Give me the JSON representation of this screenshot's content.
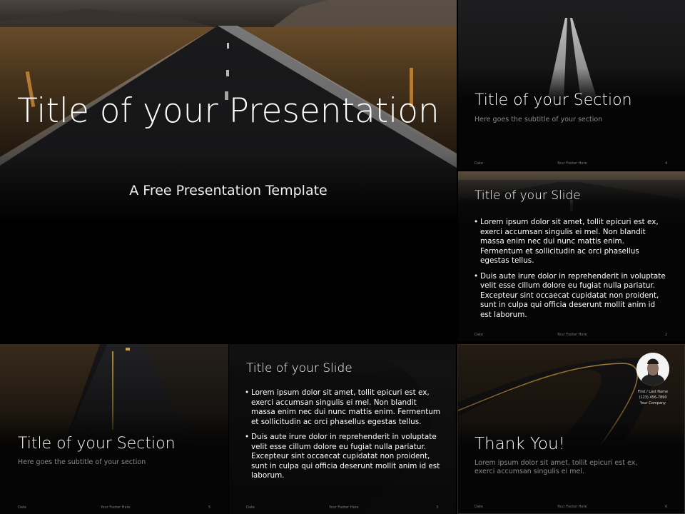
{
  "main_slide": {
    "title": "Title of your Presentation",
    "subtitle": "A Free Presentation Template"
  },
  "section_slide_1": {
    "title": "Title of your Section",
    "subtitle": "Here goes the subtitle of your section",
    "footer": {
      "date": "Date",
      "text": "Your Footer Here",
      "page": "4"
    }
  },
  "content_slide_1": {
    "title": "Title of your Slide",
    "bullets": [
      "Lorem ipsum dolor sit amet, tollit epicuri est ex, exerci accumsan singulis ei mel. Non blandit massa enim nec dui nunc mattis enim. Fermentum et sollicitudin ac orci phasellus egestas tellus.",
      "Duis aute irure dolor in reprehenderit in voluptate velit esse cillum dolore eu fugiat nulla pariatur. Excepteur sint occaecat cupidatat non proident, sunt in culpa qui officia deserunt mollit anim id est laborum."
    ],
    "footer": {
      "date": "Date",
      "text": "Your Footer Here",
      "page": "2"
    }
  },
  "section_slide_2": {
    "title": "Title of your Section",
    "subtitle": "Here goes the subtitle of your section",
    "footer": {
      "date": "Date",
      "text": "Your Footer Here",
      "page": "5"
    }
  },
  "content_slide_2": {
    "title": "Title of your Slide",
    "bullets": [
      "Lorem ipsum dolor sit amet, tollit epicuri est ex, exerci accumsan singulis ei mel. Non blandit massa enim nec dui nunc mattis enim. Fermentum et sollicitudin ac orci phasellus egestas tellus.",
      "Duis aute irure dolor in reprehenderit in voluptate velit esse cillum dolore eu fugiat nulla pariatur. Excepteur sint occaecat cupidatat non proident, sunt in culpa qui officia deserunt mollit anim id est laborum."
    ],
    "footer": {
      "date": "Date",
      "text": "Your Footer Here",
      "page": "3"
    }
  },
  "thanks_slide": {
    "title": "Thank You!",
    "body": "Lorem ipsum dolor sit amet, tollit epicuri est ex, exerci accumsan singulis ei mel.",
    "contact": {
      "name": "First / Last Name",
      "phone": "(123) 456-7890",
      "company": "Your Company"
    },
    "footer": {
      "date": "Date",
      "text": "Your Footer Here",
      "page": "6"
    }
  }
}
